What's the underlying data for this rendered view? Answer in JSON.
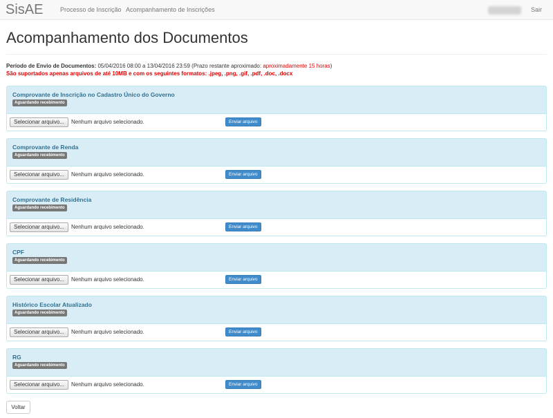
{
  "navbar": {
    "brand": "SisAE",
    "links": [
      "Processo de Inscrição",
      "Acompanhamento de Inscrições"
    ],
    "logout": "Sair"
  },
  "page": {
    "title": "Acompanhamento dos Documentos",
    "period_label": "Período de Envio de Documentos:",
    "period_value": "05/04/2016 08:00 a 13/04/2016 23:59 (Prazo restante aproximado:",
    "period_remaining": "aproximadamente 15 horas",
    "period_close": ")",
    "formats_note": "São suportados apenas arquivos de até 10MB e com os seguintes formatos: .jpeg, .png, .gif, .pdf, .doc, .docx"
  },
  "documents": [
    {
      "title": "Comprovante de Inscrição no Cadastro Único do Governo",
      "status": "Aguardando recebimento",
      "file_button": "Selecionar arquivo...",
      "file_status": "Nenhum arquivo selecionado.",
      "send_button": "Enviar arquivo"
    },
    {
      "title": "Comprovante de Renda",
      "status": "Aguardando recebimento",
      "file_button": "Selecionar arquivo...",
      "file_status": "Nenhum arquivo selecionado.",
      "send_button": "Enviar arquivo"
    },
    {
      "title": "Comprovante de Residência",
      "status": "Aguardando recebimento",
      "file_button": "Selecionar arquivo...",
      "file_status": "Nenhum arquivo selecionado.",
      "send_button": "Enviar arquivo"
    },
    {
      "title": "CPF",
      "status": "Aguardando recebimento",
      "file_button": "Selecionar arquivo...",
      "file_status": "Nenhum arquivo selecionado.",
      "send_button": "Enviar arquivo"
    },
    {
      "title": "Histórico Escolar Atualizado",
      "status": "Aguardando recebimento",
      "file_button": "Selecionar arquivo...",
      "file_status": "Nenhum arquivo selecionado.",
      "send_button": "Enviar arquivo"
    },
    {
      "title": "RG",
      "status": "Aguardando recebimento",
      "file_button": "Selecionar arquivo...",
      "file_status": "Nenhum arquivo selecionado.",
      "send_button": "Enviar arquivo"
    }
  ],
  "footer": {
    "back_button": "Voltar"
  },
  "colors": {
    "panel_heading": "#d9edf7",
    "panel_border": "#bce8f1",
    "panel_title": "#31708f",
    "badge": "#777777",
    "primary": "#428bca",
    "warning_text": "#e00000"
  }
}
